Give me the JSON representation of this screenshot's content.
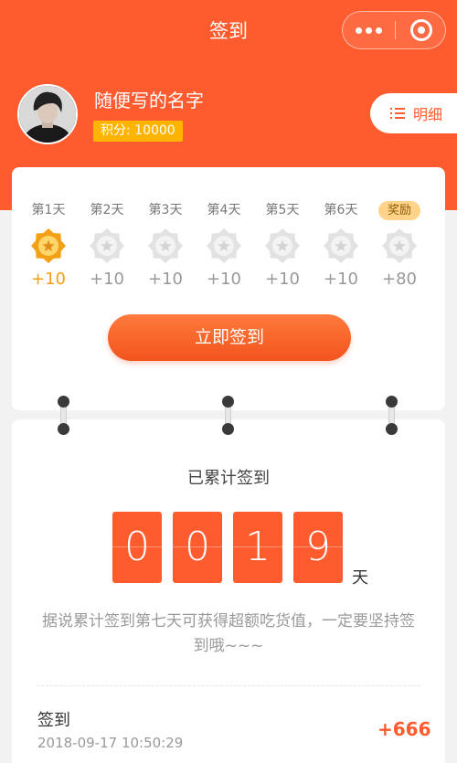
{
  "nav": {
    "title": "签到"
  },
  "user": {
    "name": "随便写的名字",
    "points": "积分: 10000"
  },
  "detail_button": {
    "label": "明细"
  },
  "days": [
    {
      "label": "第1天",
      "points": "+10",
      "signed": true
    },
    {
      "label": "第2天",
      "points": "+10",
      "signed": false
    },
    {
      "label": "第3天",
      "points": "+10",
      "signed": false
    },
    {
      "label": "第4天",
      "points": "+10",
      "signed": false
    },
    {
      "label": "第5天",
      "points": "+10",
      "signed": false
    },
    {
      "label": "第6天",
      "points": "+10",
      "signed": false
    },
    {
      "label": "奖励",
      "points": "+80",
      "signed": false
    }
  ],
  "signin_button": {
    "label": "立即签到"
  },
  "total": {
    "label": "已累计签到",
    "digits": [
      "0",
      "0",
      "1",
      "9"
    ],
    "unit": "天",
    "tip": "据说累计签到第七天可获得超额吃货值，一定要坚持签到哦~~~"
  },
  "record": {
    "title": "签到",
    "time": "2018-09-17 10:50:29",
    "points": "+666"
  },
  "colors": {
    "primary": "#fe5b2e",
    "gold": "#f4a017",
    "points_badge": "#ffb400"
  }
}
